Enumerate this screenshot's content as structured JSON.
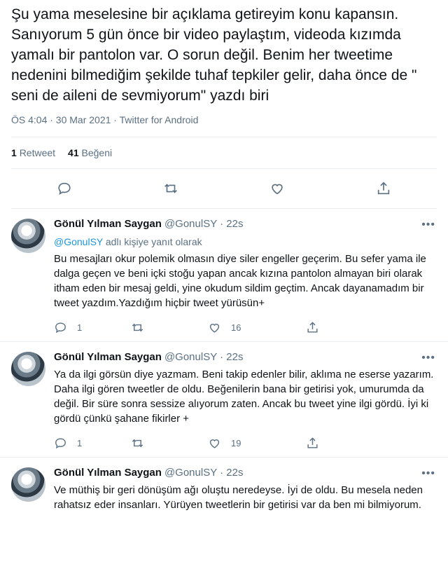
{
  "main_tweet": {
    "text": "Şu yama meselesine bir açıklama getireyim konu kapansın. Sanıyorum 5 gün önce bir video paylaştım, videoda kızımda yamalı bir pantolon var. O sorun değil. Benim her tweetime nedenini bilmediğim şekilde tuhaf tepkiler gelir, daha önce de \" seni de aileni de sevmiyorum\" yazdı biri",
    "timestamp": "ÖS 4:04 · 30 Mar 2021 · Twitter for Android",
    "retweets": "1",
    "retweets_label": "Retweet",
    "likes": "41",
    "likes_label": "Beğeni"
  },
  "replies": [
    {
      "name": "Gönül Yılman Saygan",
      "handle": "@GonulSY · 22s",
      "replying_mention": "@GonulSY",
      "replying_suffix": "adlı kişiye yanıt olarak",
      "text": "Bu mesajları okur polemik olmasın diye siler engeller geçerim. Bu sefer yama ile dalga geçen ve beni içki stoğu yapan ancak kızına pantolon almayan biri olarak itham eden bir mesaj geldi, yine okudum sildim geçtim. Ancak dayanamadım bir tweet yazdım.Yazdığım hiçbir tweet yürüsün+",
      "reply_count": "1",
      "retweet_count": "",
      "like_count": "16"
    },
    {
      "name": "Gönül Yılman Saygan",
      "handle": "@GonulSY · 22s",
      "text": "Ya da ilgi görsün diye yazmam. Beni takip edenler bilir, aklıma ne eserse yazarım. Daha ilgi gören tweetler de oldu. Beğenilerin bana bir getirisi yok, umurumda da değil. Bir süre sonra sessize alıyorum zaten. Ancak bu tweet yine ilgi gördü. İyi ki gördü çünkü şahane fikirler +",
      "reply_count": "1",
      "retweet_count": "",
      "like_count": "19"
    },
    {
      "name": "Gönül Yılman Saygan",
      "handle": "@GonulSY · 22s",
      "text": "Ve müthiş bir geri dönüşüm ağı oluştu neredeyse. İyi de oldu. Bu mesela neden rahatsız eder insanları. Yürüyen tweetlerin bir getirisi var da ben mi bilmiyorum."
    }
  ],
  "icons": {
    "reply": "reply-icon",
    "retweet": "retweet-icon",
    "like": "heart-icon",
    "share": "share-icon",
    "more": "more-icon"
  },
  "colors": {
    "link": "#1b95e0",
    "secondary_text": "#5b7083",
    "divider": "#ebeef0"
  }
}
